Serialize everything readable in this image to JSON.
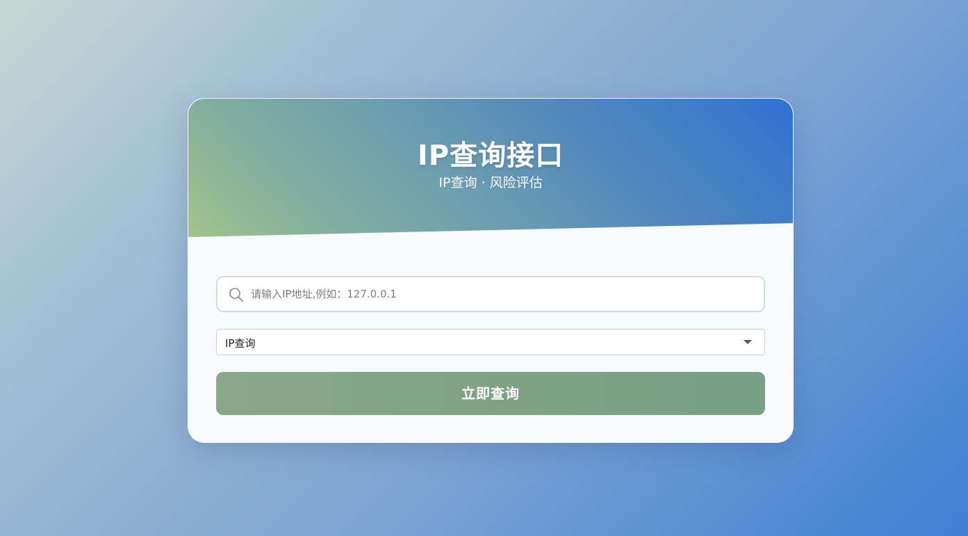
{
  "header": {
    "title": "IP查询接口",
    "subtitle": "IP查询 · 风险评估"
  },
  "search": {
    "placeholder": "请输入IP地址,例如：127.0.0.1",
    "value": "",
    "icon": "search-icon"
  },
  "query_type": {
    "selected": "IP查询"
  },
  "submit": {
    "label": "立即查询"
  },
  "colors": {
    "accent_green": "#7ea283",
    "header_blue": "#2f70d4",
    "header_green": "#a3c48a"
  }
}
